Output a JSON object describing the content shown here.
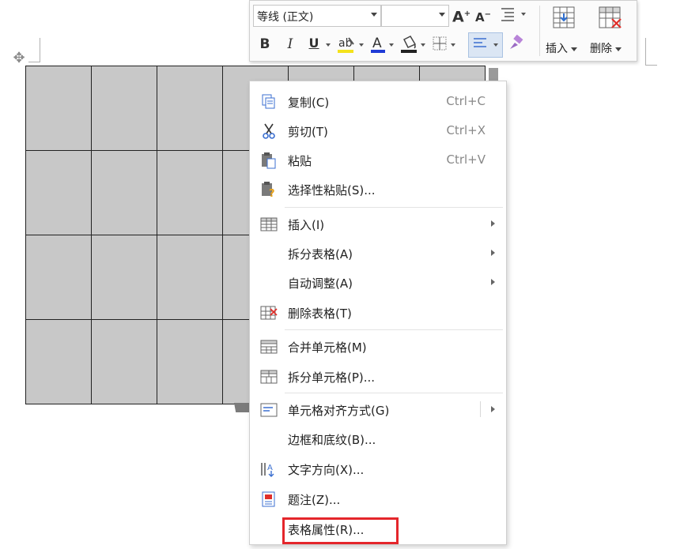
{
  "toolbar": {
    "font_name": "等线 (正文)",
    "font_size": "",
    "grow_font": "A",
    "shrink_font": "A",
    "bold": "B",
    "italic": "I",
    "underline": "U",
    "font_color": "A",
    "insert_label": "插入",
    "delete_label": "删除"
  },
  "menu": {
    "items": [
      {
        "label": "复制(C)",
        "shortcut": "Ctrl+C",
        "icon": "copy-icon"
      },
      {
        "label": "剪切(T)",
        "shortcut": "Ctrl+X",
        "icon": "scissors-icon"
      },
      {
        "label": "粘贴",
        "shortcut": "Ctrl+V",
        "icon": "paste-icon"
      },
      {
        "label": "选择性粘贴(S)...",
        "shortcut": "",
        "icon": "paste-special-icon"
      },
      {
        "label": "插入(I)",
        "shortcut": "",
        "icon": "table-insert-icon",
        "submenu": true
      },
      {
        "label": "拆分表格(A)",
        "shortcut": "",
        "icon": "",
        "submenu": true
      },
      {
        "label": "自动调整(A)",
        "shortcut": "",
        "icon": "",
        "submenu": true
      },
      {
        "label": "删除表格(T)",
        "shortcut": "",
        "icon": "delete-table-icon"
      },
      {
        "label": "合并单元格(M)",
        "shortcut": "",
        "icon": "merge-cells-icon"
      },
      {
        "label": "拆分单元格(P)...",
        "shortcut": "",
        "icon": "split-cells-icon"
      },
      {
        "label": "单元格对齐方式(G)",
        "shortcut": "",
        "icon": "cell-align-icon",
        "submenu": true
      },
      {
        "label": "边框和底纹(B)...",
        "shortcut": "",
        "icon": ""
      },
      {
        "label": "文字方向(X)...",
        "shortcut": "",
        "icon": "text-direction-icon"
      },
      {
        "label": "题注(Z)...",
        "shortcut": "",
        "icon": "caption-icon"
      },
      {
        "label": "表格属性(R)...",
        "shortcut": "",
        "icon": "",
        "highlighted": true
      }
    ]
  },
  "colors": {
    "highlight_box": "#e4262b",
    "table_fill": "#c8c8c8",
    "accent_blue": "#3b6fd0"
  }
}
